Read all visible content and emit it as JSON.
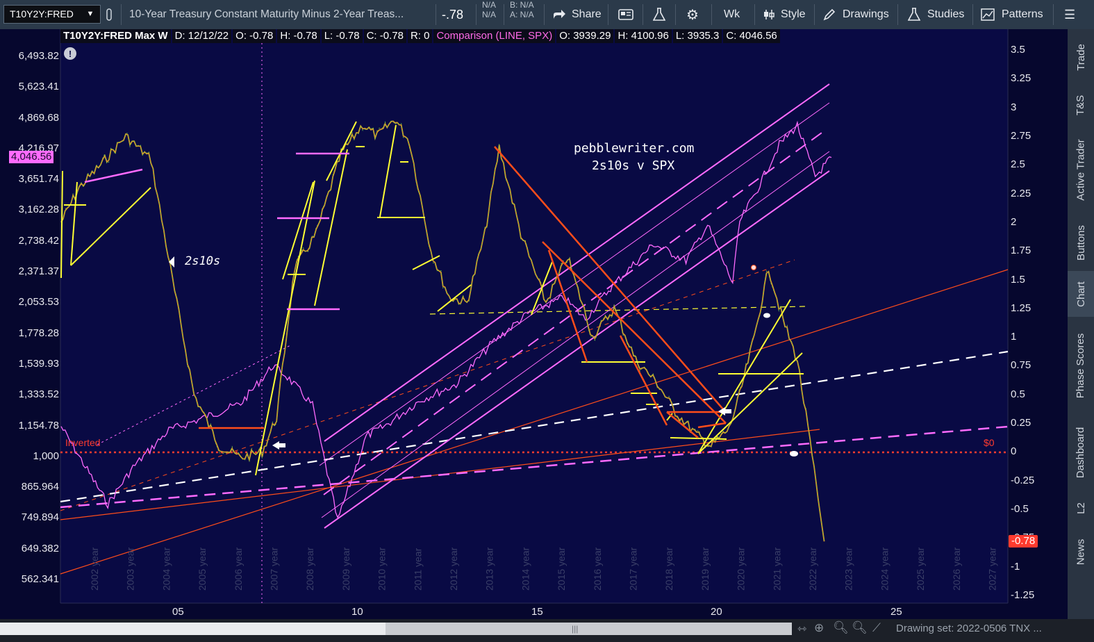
{
  "toolbar": {
    "symbol": "T10Y2Y:FRED",
    "description": "10-Year Treasury Constant Maturity Minus 2-Year Treas...",
    "last": "-.78",
    "bid_size_1": "N/A",
    "bid_size_2": "N/A",
    "bid": "B: N/A",
    "ask": "A: N/A",
    "share": "Share",
    "timeframe": "Wk",
    "style": "Style",
    "drawings": "Drawings",
    "studies": "Studies",
    "patterns": "Patterns"
  },
  "legend": {
    "title": "T10Y2Y:FRED Max W",
    "date": "D: 12/12/22",
    "open": "O: -0.78",
    "high": "H: -0.78",
    "low": "L: -0.78",
    "close": "C: -0.78",
    "range": "R: 0",
    "comparison": "Comparison (LINE, SPX)",
    "cmp_open": "O: 3939.29",
    "cmp_high": "H: 4100.96",
    "cmp_low": "L: 3935.3",
    "cmp_close": "C: 4046.56"
  },
  "annotations": {
    "site": "pebblewriter.com",
    "subtitle": "2s10s v SPX",
    "series_label": "2s10s",
    "inverted": "Inverted",
    "zero": "$0",
    "spx_price": "4,046.56",
    "t10_price": "-0.78"
  },
  "chart_data": {
    "type": "line",
    "left_axis_ticks": [
      "6,493.82",
      "5,623.41",
      "4,869.68",
      "4,216.97",
      "3,651.74",
      "3,162.28",
      "2,738.42",
      "2,371.37",
      "2,053.53",
      "1,778.28",
      "1,539.93",
      "1,333.52",
      "1,154.78",
      "1,000",
      "865.964",
      "749.894",
      "649.382",
      "562.341"
    ],
    "right_axis_ticks": [
      "3.5",
      "3.25",
      "3",
      "2.75",
      "2.5",
      "2.25",
      "2",
      "1.75",
      "1.5",
      "1.25",
      "1",
      "0.75",
      "0.5",
      "0.25",
      "0",
      "-0.25",
      "-0.5",
      "-0.75",
      "-1",
      "-1.25"
    ],
    "x_year_labels": [
      "2002 year",
      "2003 year",
      "2004 year",
      "2005 year",
      "2006 year",
      "2007 year",
      "2008 year",
      "2009 year",
      "2010 year",
      "2011 year",
      "2012 year",
      "2013 year",
      "2014 year",
      "2015 year",
      "2016 year",
      "2017 year",
      "2018 year",
      "2019 year",
      "2020 year",
      "2021 year",
      "2022 year",
      "2023 year",
      "2024 year",
      "2025 year",
      "2026 year",
      "2027 year"
    ],
    "x_bottom_labels": [
      "05",
      "10",
      "15",
      "20",
      "25"
    ],
    "series": [
      {
        "name": "T10Y2Y:FRED",
        "x": [
          2001.5,
          2002,
          2002.6,
          2003.3,
          2004,
          2004.6,
          2005.2,
          2005.9,
          2006.5,
          2007.1,
          2007.5,
          2008,
          2008.6,
          2009.3,
          2009.9,
          2010.3,
          2010.8,
          2011.2,
          2011.8,
          2012.3,
          2012.8,
          2013.3,
          2013.7,
          2014.3,
          2015,
          2015.6,
          2016.3,
          2016.9,
          2017.5,
          2018.1,
          2018.6,
          2019.2,
          2019.6,
          2020.1,
          2020.4,
          2020.8,
          2021.2,
          2021.6,
          2022,
          2022.3,
          2022.75
        ],
        "values": [
          2.0,
          2.3,
          2.5,
          2.75,
          2.55,
          1.5,
          0.5,
          0.05,
          -0.05,
          0.0,
          0.3,
          1.6,
          1.9,
          2.6,
          2.85,
          2.75,
          2.9,
          2.7,
          1.75,
          1.35,
          1.3,
          1.9,
          2.65,
          1.9,
          1.3,
          1.7,
          1.0,
          1.25,
          0.8,
          0.6,
          0.35,
          0.15,
          0.05,
          0.2,
          0.5,
          1.0,
          1.6,
          1.15,
          0.8,
          0.2,
          -0.78
        ]
      },
      {
        "name": "SPX",
        "x": [
          2001.5,
          2002,
          2002.8,
          2003.5,
          2004.5,
          2005.5,
          2006.5,
          2007.4,
          2007.8,
          2008.5,
          2009.2,
          2010,
          2010.5,
          2011.5,
          2012.5,
          2013.5,
          2014.5,
          2015.5,
          2016.1,
          2016.8,
          2018,
          2018.9,
          2019.5,
          2020.2,
          2020.4,
          2020.9,
          2021.5,
          2022,
          2022.5,
          2022.95
        ],
        "values": [
          1150,
          1000,
          800,
          950,
          1130,
          1200,
          1280,
          1530,
          1450,
          1270,
          740,
          1100,
          1150,
          1300,
          1400,
          1700,
          1950,
          2100,
          1900,
          2200,
          2700,
          2500,
          2950,
          2250,
          3000,
          3500,
          4300,
          4700,
          3700,
          4046.56
        ]
      }
    ],
    "ylim_left": [
      562.341,
      6493.82
    ],
    "ylim_right": [
      -1.25,
      3.5
    ],
    "grid": false,
    "scale_left": "log"
  },
  "sidebar": [
    "Trade",
    "T&S",
    "Active Trader",
    "Buttons",
    "Chart",
    "Phase Scores",
    "Dashboard",
    "L2",
    "News"
  ],
  "bottom_bar": {
    "drawing_set": "Drawing set: 2022-0506 TNX ..."
  },
  "colors": {
    "background": "#090a44",
    "spx": "#ff6bff",
    "trend_yellow": "#ffff33",
    "trend_orange": "#ff4d1a",
    "zero_line": "#ff3b2f"
  }
}
